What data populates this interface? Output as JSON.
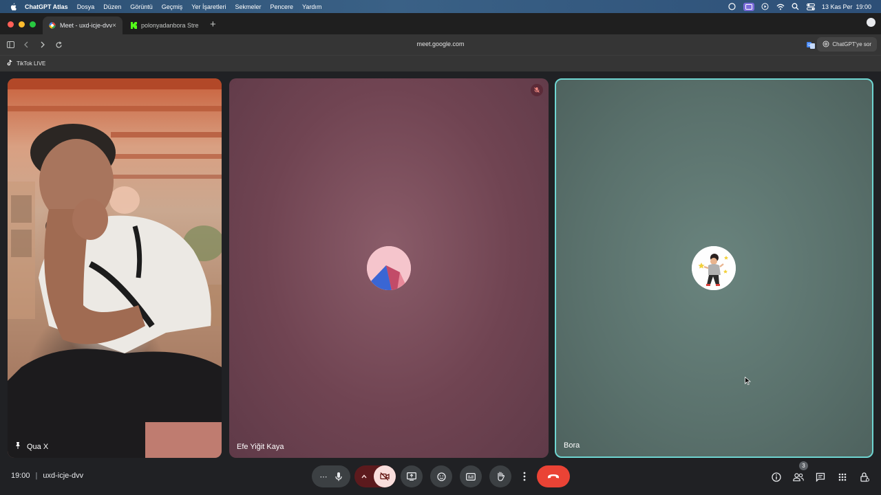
{
  "menubar": {
    "app_name": "ChatGPT Atlas",
    "items": [
      "Dosya",
      "Düzen",
      "Görüntü",
      "Geçmiş",
      "Yer İşaretleri",
      "Sekmeler",
      "Pencere",
      "Yardım"
    ],
    "clock": "13 Kas Per  19:00"
  },
  "tabs": [
    {
      "label": "Meet - uxd-icje-dvv",
      "icon": "google-meet-icon"
    },
    {
      "label": "polonyadanbora Stre",
      "icon": "kick-icon"
    }
  ],
  "toolbar": {
    "url": "meet.google.com",
    "ask_label": "ChatGPT'ye sor"
  },
  "bookmarks": {
    "items": [
      {
        "label": "TikTok LIVE",
        "icon": "tiktok-icon"
      }
    ]
  },
  "participants": [
    {
      "name": "Qua X",
      "pinned": true
    },
    {
      "name": "Efe Yiğit Kaya",
      "muted": true
    },
    {
      "name": "Bora",
      "speaking": true
    }
  ],
  "meeting": {
    "time": "19:00",
    "separator": "|",
    "code": "uxd-icje-dvv"
  },
  "people_count": "3",
  "colors": {
    "leave_red": "#ea4335",
    "speaking_border": "#6fd6d2",
    "camera_off_bg": "#f9dedc"
  }
}
